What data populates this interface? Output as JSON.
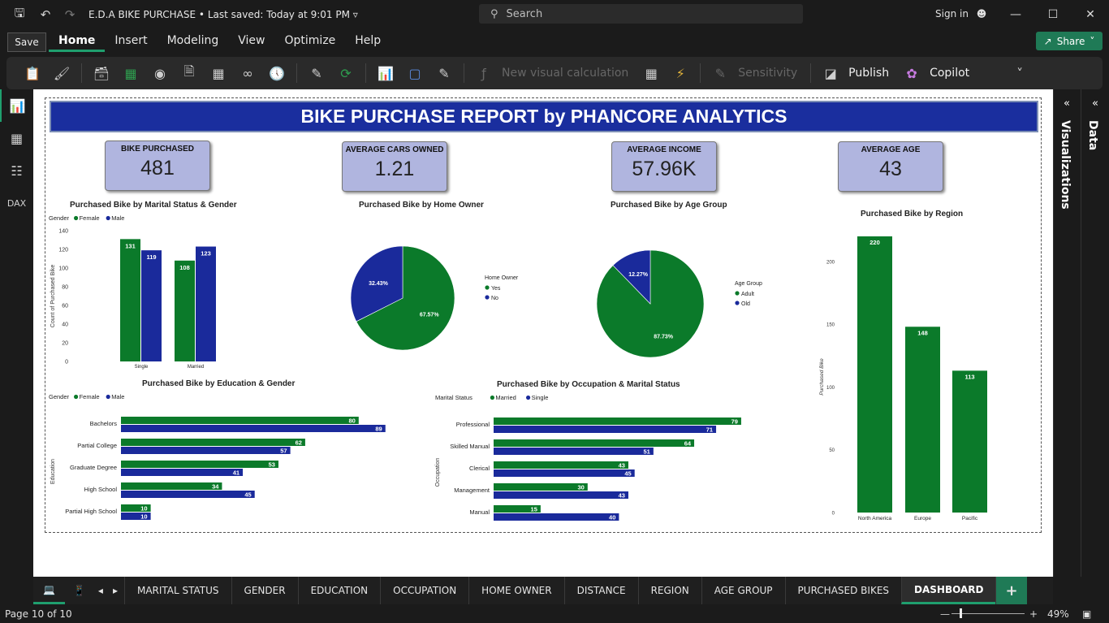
{
  "app": {
    "doc_title": "E.D.A BIKE PURCHASE",
    "last_saved": "Last saved: Today at 9:01 PM",
    "search_placeholder": "Search",
    "sign_in": "Sign in",
    "save_tooltip": "Save",
    "share": "Share"
  },
  "menu": [
    "Home",
    "Insert",
    "Modeling",
    "View",
    "Optimize",
    "Help"
  ],
  "ribbon": {
    "new_visual_calc": "New visual calculation",
    "sensitivity": "Sensitivity",
    "publish": "Publish",
    "copilot": "Copilot"
  },
  "right_panels": {
    "visualizations": "Visualizations",
    "data": "Data"
  },
  "report": {
    "banner": "BIKE PURCHASE REPORT by PHANCORE ANALYTICS",
    "cards": [
      {
        "label": "BIKE PURCHASED",
        "value": "481"
      },
      {
        "label": "AVERAGE CARS OWNED",
        "value": "1.21"
      },
      {
        "label": "AVERAGE INCOME",
        "value": "57.96K"
      },
      {
        "label": "AVERAGE AGE",
        "value": "43"
      }
    ]
  },
  "colors": {
    "green": "#0b7a2a",
    "blue": "#1a2a9b"
  },
  "chart_data": [
    {
      "type": "bar",
      "title": "Purchased Bike by Marital Status & Gender",
      "legend_title": "Gender",
      "categories": [
        "Single",
        "Married"
      ],
      "series": [
        {
          "name": "Female",
          "values": [
            131,
            108
          ]
        },
        {
          "name": "Male",
          "values": [
            119,
            123
          ]
        }
      ],
      "ylabel": "Count of Purchased Bike",
      "ylim": [
        0,
        140
      ],
      "yticks": [
        0,
        20,
        40,
        60,
        80,
        100,
        120,
        140
      ],
      "legend": "top-left"
    },
    {
      "type": "pie",
      "title": "Purchased Bike by Home Owner",
      "legend_title": "Home Owner",
      "labels": [
        "Yes",
        "No"
      ],
      "values": [
        67.57,
        32.43
      ],
      "value_labels": [
        "67.57%",
        "32.43%"
      ],
      "legend": "right"
    },
    {
      "type": "pie",
      "title": "Purchased Bike by Age Group",
      "legend_title": "Age Group",
      "labels": [
        "Adult",
        "Old"
      ],
      "values": [
        87.73,
        12.27
      ],
      "value_labels": [
        "87.73%",
        "12.27%"
      ],
      "legend": "right"
    },
    {
      "type": "bar",
      "title": "Purchased Bike by Region",
      "categories": [
        "North America",
        "Europe",
        "Pacific"
      ],
      "values": [
        220,
        148,
        113
      ],
      "ylabel": "Purchased Bike",
      "ylim": [
        0,
        220
      ],
      "yticks": [
        0,
        50,
        100,
        150,
        200
      ]
    },
    {
      "type": "bar",
      "orientation": "horizontal",
      "title": "Purchased Bike by Education & Gender",
      "legend_title": "Gender",
      "categories": [
        "Bachelors",
        "Partial College",
        "Graduate Degree",
        "High School",
        "Partial High School"
      ],
      "series": [
        {
          "name": "Female",
          "values": [
            80,
            62,
            53,
            34,
            10
          ]
        },
        {
          "name": "Male",
          "values": [
            89,
            57,
            41,
            45,
            10
          ]
        }
      ],
      "ylabel": "Education",
      "legend": "top-left"
    },
    {
      "type": "bar",
      "orientation": "horizontal",
      "title": "Purchased Bike by Occupation & Marital Status",
      "legend_title": "Marital Status",
      "categories": [
        "Professional",
        "Skilled Manual",
        "Clerical",
        "Management",
        "Manual"
      ],
      "series": [
        {
          "name": "Married",
          "values": [
            79,
            64,
            43,
            30,
            15
          ]
        },
        {
          "name": "Single",
          "values": [
            71,
            51,
            45,
            43,
            40
          ]
        }
      ],
      "ylabel": "Occupation",
      "legend": "top-left"
    }
  ],
  "tabs": [
    "MARITAL STATUS",
    "GENDER",
    "EDUCATION",
    "OCCUPATION",
    "HOME OWNER",
    "DISTANCE",
    "REGION",
    "AGE GROUP",
    "PURCHASED BIKES",
    "DASHBOARD"
  ],
  "active_tab": "DASHBOARD",
  "status": {
    "page": "Page 10 of 10",
    "zoom": "49%"
  }
}
